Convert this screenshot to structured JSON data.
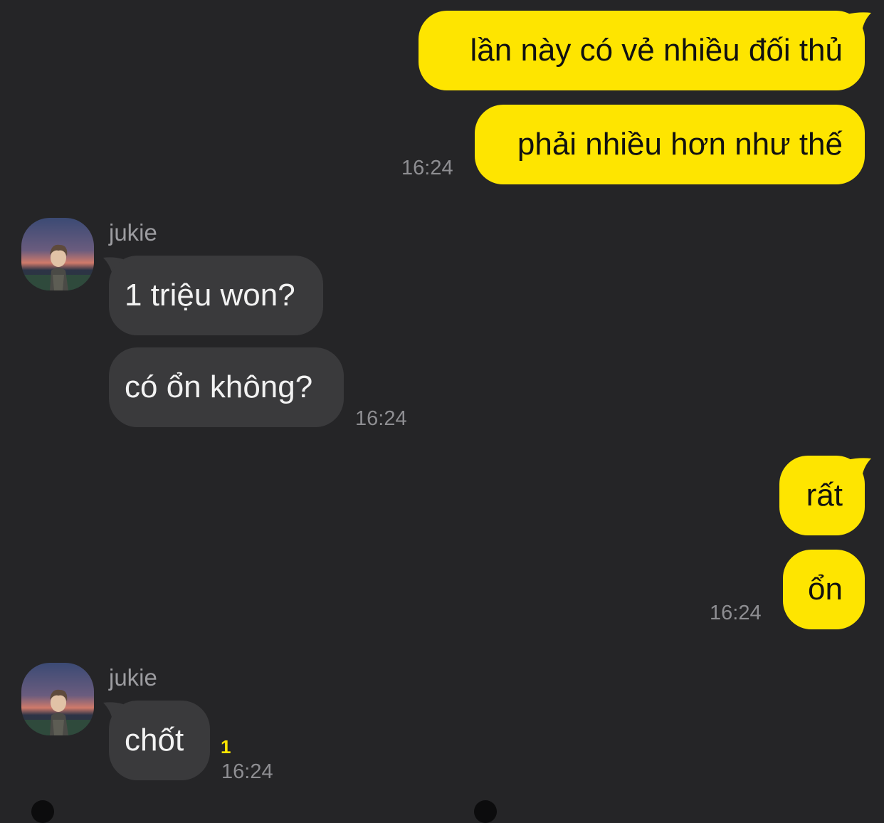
{
  "colors": {
    "background": "#252527",
    "outgoing_bubble": "#fee500",
    "incoming_bubble": "#3a3a3c",
    "timestamp": "#8e8e92",
    "unread_indicator": "#fee500"
  },
  "messages": {
    "out1": {
      "text": "lần này có vẻ nhiều đối thủ"
    },
    "out2": {
      "text": "phải nhiều hơn như thế",
      "time": "16:24"
    },
    "group1": {
      "sender": "jukie",
      "avatar_icon": "profile-photo-sunset",
      "in1": {
        "text": "1 triệu won?"
      },
      "in2": {
        "text": "có ổn không?",
        "time": "16:24"
      }
    },
    "out3": {
      "text": "rất"
    },
    "out4": {
      "text": "ổn",
      "time": "16:24"
    },
    "group2": {
      "sender": "jukie",
      "avatar_icon": "profile-photo-sunset",
      "in3": {
        "text": "chốt",
        "unread": "1",
        "time": "16:24"
      }
    }
  }
}
